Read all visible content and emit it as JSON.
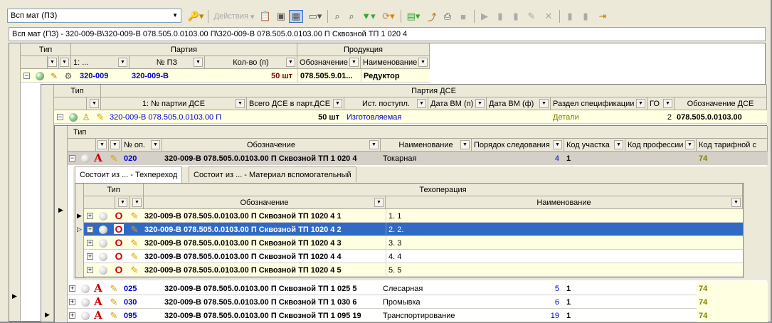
{
  "toolbar": {
    "view_select": "Всп мат (ПЗ)",
    "actions_label": "Действия",
    "icons": [
      "key-icon",
      "copy-icon",
      "paste-icon",
      "grid-icon",
      "panel-icon",
      "search-icon",
      "find-icon",
      "filter-icon",
      "refresh-icon",
      "settings-icon",
      "export-icon",
      "print-icon",
      "stop-icon",
      "play-icon",
      "doc-icon",
      "doc2-icon",
      "edit-icon",
      "close-icon",
      "nav-icon",
      "nav2-icon",
      "forward-icon"
    ]
  },
  "path": "Всп мат (ПЗ) - 320-009-В\\320-009-В 078.505.0.0103.00 П\\320-009-В 078.505.0.0103.00 П Сквозной ТП 1 020 4",
  "grid1": {
    "group_tip": "Тип",
    "group_party": "Партия",
    "group_product": "Продукция",
    "col_1": "1: ...",
    "col_pz": "№ ПЗ",
    "col_qty": "Кол-во (п)",
    "col_design": "Обозначение",
    "col_name": "Наименование",
    "row": {
      "code": "320-009",
      "pz": "320-009-В",
      "qty": "50 шт",
      "design": "078.505.9.01...",
      "name": "Редуктор"
    }
  },
  "grid2": {
    "group_tip": "Тип",
    "group_party": "Партия ДСЕ",
    "col_party": "1: № партии ДСЕ",
    "col_total": "Всего ДСЕ в парт.ДСЕ",
    "col_source": "Ист. поступл.",
    "col_datepl": "Дата ВМ (п)",
    "col_datefact": "Дата ВМ (ф)",
    "col_section": "Раздел спецификации",
    "col_go": "ГО",
    "col_design": "Обозначение ДСЕ",
    "row": {
      "party": "320-009-В 078.505.0.0103.00 П",
      "total": "50 шт",
      "source": "Изготовляемая",
      "section": "Детали",
      "go": "2",
      "design": "078.505.0.0103.00"
    }
  },
  "grid3": {
    "group_tip": "Тип",
    "col_op": "№ оп.",
    "col_design": "Обозначение",
    "col_name": "Наименование",
    "col_order": "Порядок следования",
    "col_area": "Код участка",
    "col_prof": "Код профессии",
    "col_tariff": "Код тарифной с",
    "rows": [
      {
        "op": "020",
        "design": "320-009-В 078.505.0.0103.00 П Сквозной ТП 1 020 4",
        "name": "Токарная",
        "order": "4",
        "area": "1",
        "tariff": "74"
      },
      {
        "op": "025",
        "design": "320-009-В 078.505.0.0103.00 П Сквозной ТП 1 025 5",
        "name": "Слесарная",
        "order": "5",
        "area": "1",
        "tariff": "74"
      },
      {
        "op": "030",
        "design": "320-009-В 078.505.0.0103.00 П Сквозной ТП 1 030 6",
        "name": "Промывка",
        "order": "6",
        "area": "1",
        "tariff": "74"
      },
      {
        "op": "095",
        "design": "320-009-В 078.505.0.0103.00 П Сквозной ТП 1 095 19",
        "name": "Транспортирование",
        "order": "19",
        "area": "1",
        "tariff": "74"
      }
    ]
  },
  "tabs": [
    "Состоит из ... - Техпереход",
    "Состоит из ... - Материал вспомогательный"
  ],
  "grid4": {
    "group_tip": "Тип",
    "group_op": "Техоперация",
    "col_design": "Обозначение",
    "col_name": "Наименование",
    "rows": [
      {
        "design": "320-009-В 078.505.0.0103.00 П Сквозной ТП 1020 4 1",
        "name": "1. 1"
      },
      {
        "design": "320-009-В 078.505.0.0103.00 П Сквозной ТП 1020 4 2",
        "name": "2. 2."
      },
      {
        "design": "320-009-В 078.505.0.0103.00 П Сквозной ТП 1020 4 3",
        "name": "3. 3"
      },
      {
        "design": "320-009-В 078.505.0.0103.00 П Сквозной ТП 1020 4 4",
        "name": "4. 4"
      },
      {
        "design": "320-009-В 078.505.0.0103.00 П Сквозной ТП 1020 4 5",
        "name": "5. 5"
      }
    ]
  },
  "colors": {
    "selection": "#316ac5",
    "highlight": "#ffffe1",
    "header": "#ece9d8",
    "link": "#0000cc"
  }
}
